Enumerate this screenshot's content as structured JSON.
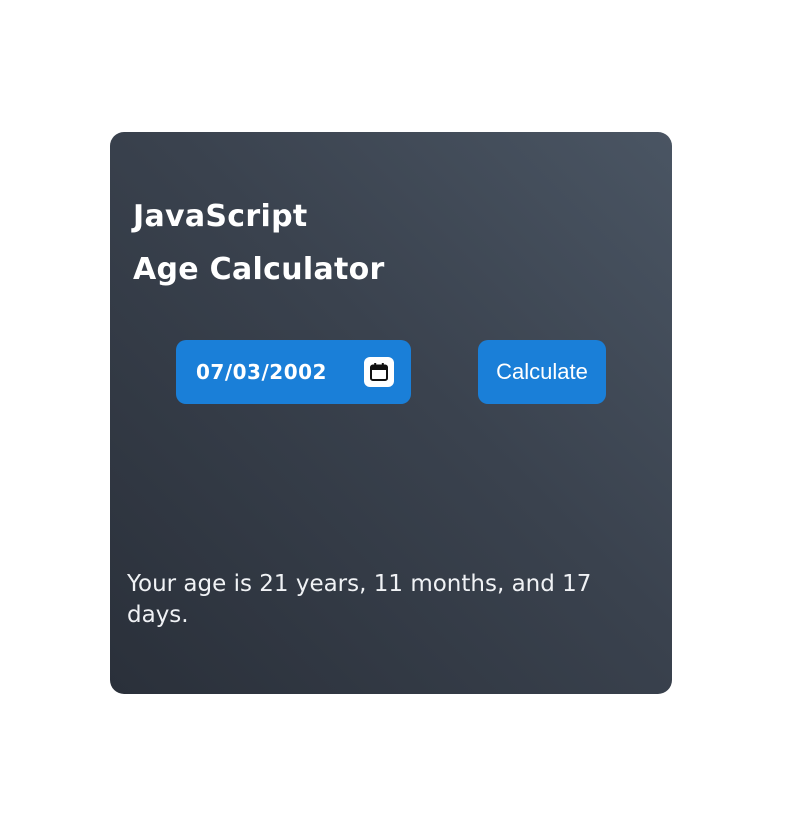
{
  "title": {
    "line1": "JavaScript",
    "line2": "Age Calculator"
  },
  "date_input": {
    "value": "07/03/2002",
    "icon": "calendar-icon"
  },
  "calculate_button": {
    "label": "Calculate"
  },
  "result": {
    "text": "Your age is 21 years, 11 months, and 17 days."
  },
  "colors": {
    "accent": "#1a7fd8",
    "card_start": "#2a303a",
    "card_end": "#4a5563",
    "text": "#ffffff"
  }
}
